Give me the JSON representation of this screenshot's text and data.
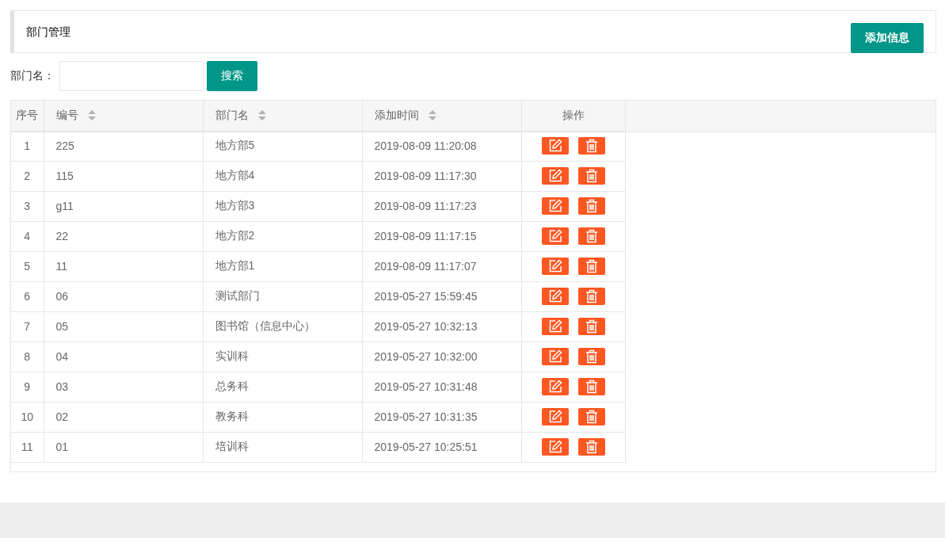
{
  "header": {
    "title": "部门管理",
    "add_button": "添加信息"
  },
  "search": {
    "label": "部门名：",
    "button": "搜索"
  },
  "table": {
    "columns": [
      {
        "label": "序号",
        "sortable": false
      },
      {
        "label": "编号",
        "sortable": true
      },
      {
        "label": "部门名",
        "sortable": true
      },
      {
        "label": "添加时间",
        "sortable": true
      },
      {
        "label": "操作",
        "sortable": false
      }
    ],
    "rows": [
      [
        "1",
        "225",
        "地方部5",
        "2019-08-09 11:20:08"
      ],
      [
        "2",
        "115",
        "地方部4",
        "2019-08-09 11:17:30"
      ],
      [
        "3",
        "g11",
        "地方部3",
        "2019-08-09 11:17:23"
      ],
      [
        "4",
        "22",
        "地方部2",
        "2019-08-09 11:17:15"
      ],
      [
        "5",
        "11",
        "地方部1",
        "2019-08-09 11:17:07"
      ],
      [
        "6",
        "06",
        "测试部门",
        "2019-05-27 15:59:45"
      ],
      [
        "7",
        "05",
        "图书馆（信息中心）",
        "2019-05-27 10:32:13"
      ],
      [
        "8",
        "04",
        "实训科",
        "2019-05-27 10:32:00"
      ],
      [
        "9",
        "03",
        "总务科",
        "2019-05-27 10:31:48"
      ],
      [
        "10",
        "02",
        "教务科",
        "2019-05-27 10:31:35"
      ],
      [
        "11",
        "01",
        "培训科",
        "2019-05-27 10:25:51"
      ]
    ]
  }
}
